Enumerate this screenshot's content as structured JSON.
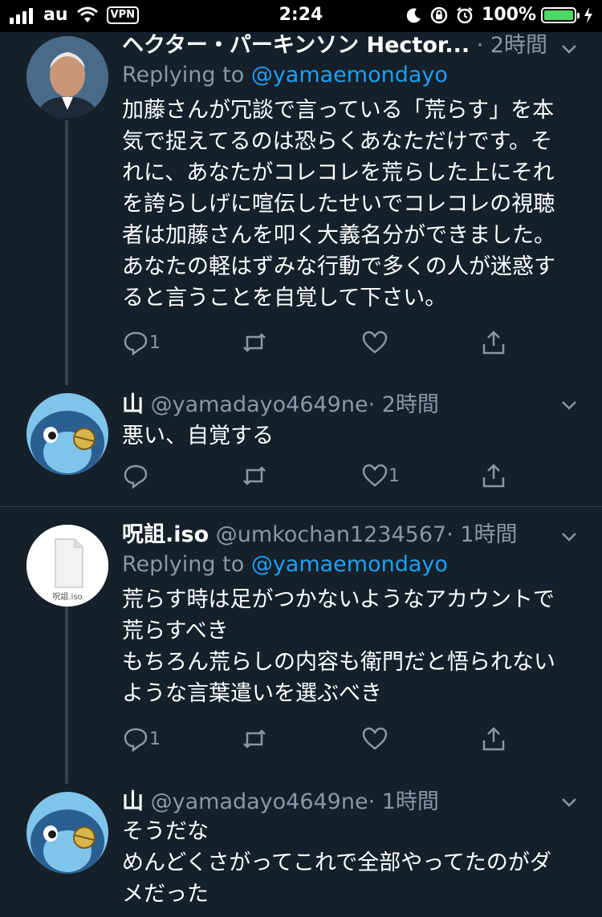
{
  "status_bar": {
    "carrier": "au",
    "vpn": "VPN",
    "time": "2:24",
    "battery": "100%"
  },
  "tweets": [
    {
      "name": "ヘクター・パーキンソン Hector...",
      "meta": "· 2時間",
      "replying_prefix": "Replying to",
      "replying_to": "@yamaemondayo",
      "text": "加藤さんが冗談で言っている「荒らす」を本\n気で捉えてるのは恐らくあなただけです。そ\nれに、あなたがコレコレを荒らした上にそれ\nを誇らしげに喧伝したせいでコレコレの視聴\n者は加藤さんを叩く大義名分ができました。\nあなたの軽はずみな行動で多くの人が迷惑す\nると言うことを自覚して下さい。",
      "reply_count": "1",
      "retweet_count": "",
      "like_count": ""
    },
    {
      "name": "山",
      "handle": "@yamadayo4649ne",
      "meta": "· 2時間",
      "text": "悪い、自覚する",
      "reply_count": "",
      "retweet_count": "",
      "like_count": "1"
    },
    {
      "name": "呪詛.iso",
      "handle": "@umkochan1234567",
      "meta": "· 1時間",
      "replying_prefix": "Replying to",
      "replying_to": "@yamaemondayo",
      "avatar_label": "呪詛.iso",
      "text": "荒らす時は足がつかないようなアカウントで\n荒らすべき\nもちろん荒らしの内容も衛門だと悟られない\nような言葉遣いを選ぶべき",
      "reply_count": "1",
      "retweet_count": "",
      "like_count": ""
    },
    {
      "name": "山",
      "handle": "@yamadayo4649ne",
      "meta": "· 1時間",
      "text": "そうだな\nめんどくさがってこれで全部やってたのがダ\nメだった"
    }
  ],
  "colors": {
    "background": "#15202b",
    "secondary_text": "#8899a6",
    "link": "#1da1f2",
    "divider": "#38444d"
  }
}
